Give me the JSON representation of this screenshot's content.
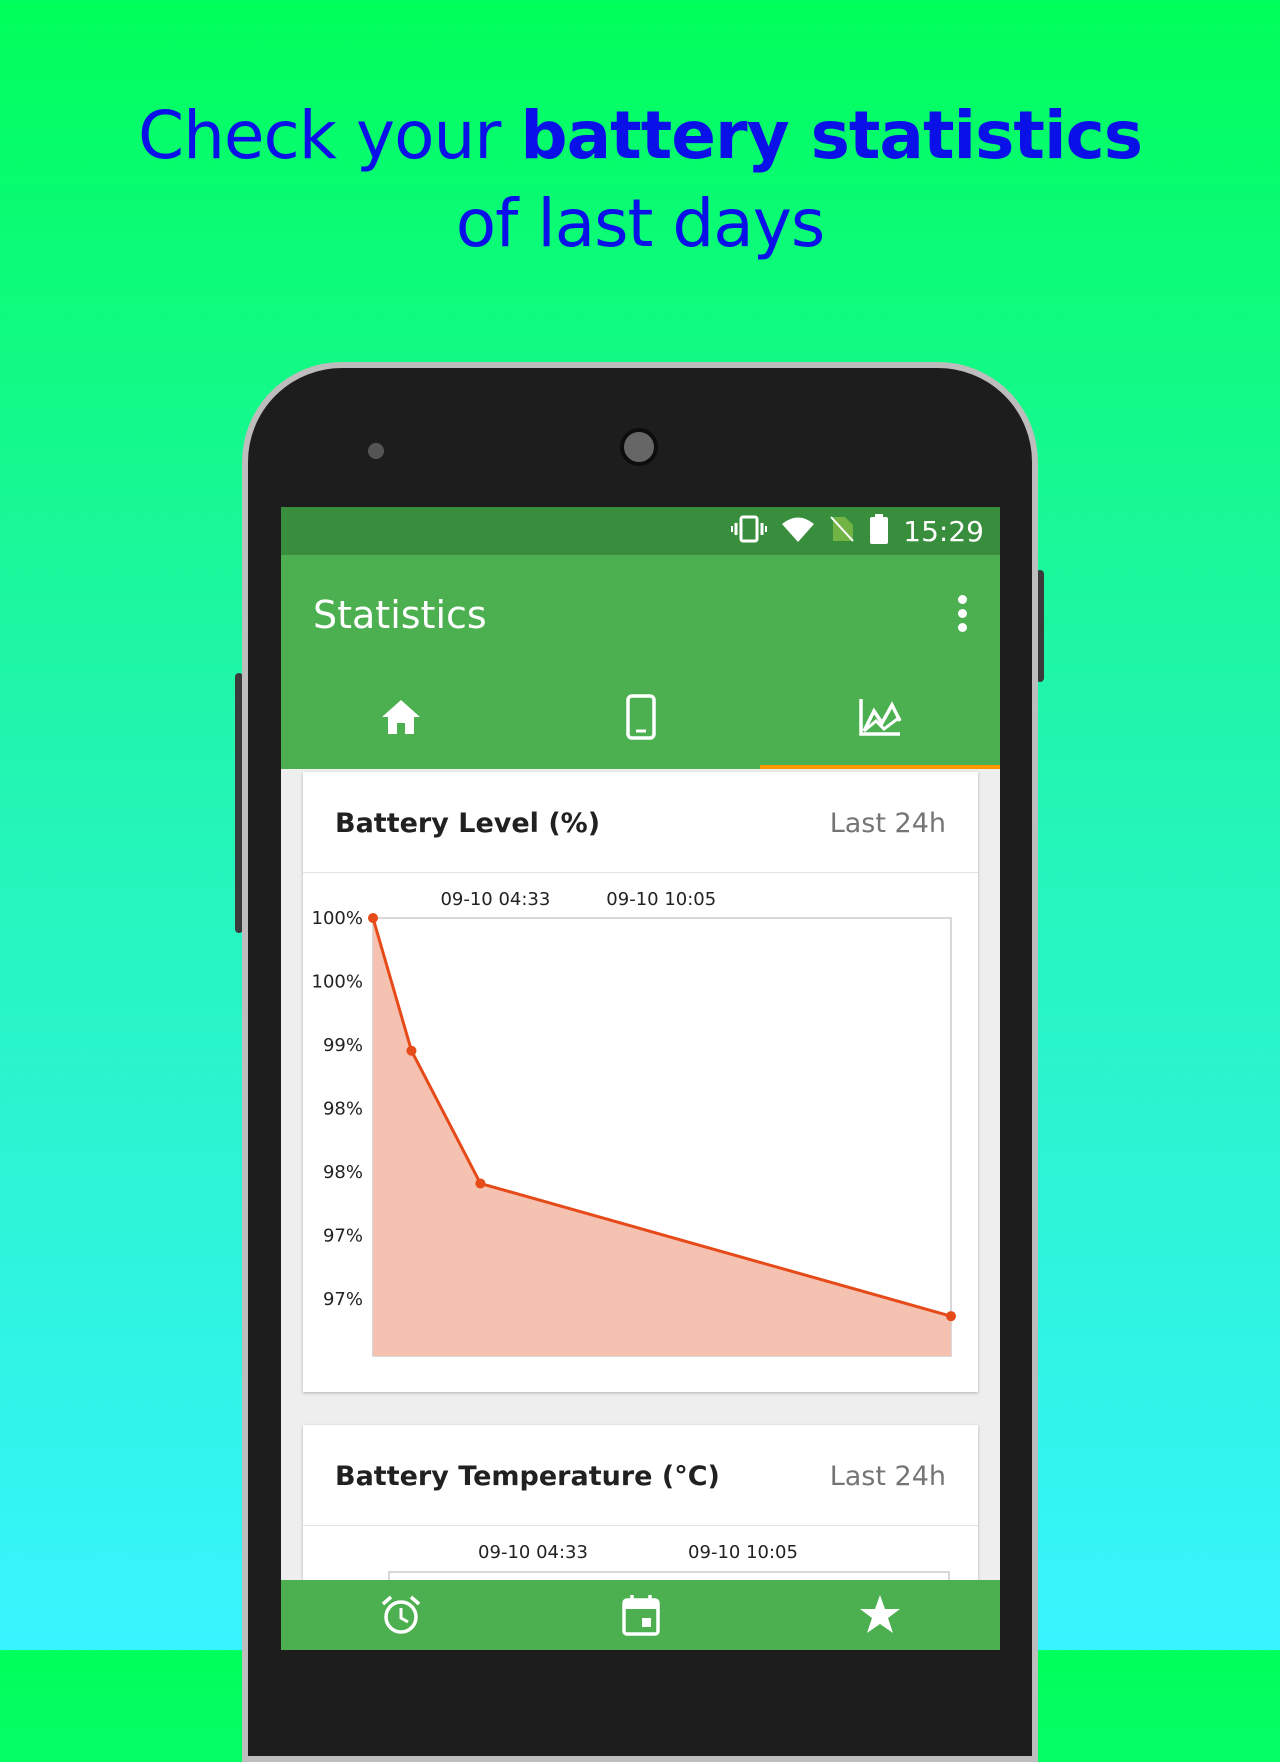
{
  "promo": {
    "line1_prefix": "Check your ",
    "line1_bold": "battery statistics",
    "line2": "of last days"
  },
  "status_bar": {
    "time": "15:29",
    "icons": [
      "vibrate-icon",
      "wifi-icon",
      "no-sim-icon",
      "battery-icon"
    ]
  },
  "app_bar": {
    "title": "Statistics",
    "menu_icon": "more-vert-icon"
  },
  "tabs": [
    {
      "icon": "home-icon",
      "active": false
    },
    {
      "icon": "phone-icon",
      "active": false
    },
    {
      "icon": "chart-icon",
      "active": true
    }
  ],
  "cards": {
    "level": {
      "title": "Battery Level (%)",
      "range": "Last 24h"
    },
    "temperature": {
      "title": "Battery Temperature (°C)",
      "range": "Last 24h"
    }
  },
  "chart_data": [
    {
      "type": "area",
      "title": "Battery Level (%)",
      "x_tick_labels": [
        "09-10 04:33",
        "09-10 10:05"
      ],
      "y_tick_labels": [
        "100%",
        "100%",
        "99%",
        "98%",
        "98%",
        "97%",
        "97%"
      ],
      "ylim": [
        96.7,
        100
      ],
      "series": [
        {
          "color": "#e64a19",
          "fill": "#f5c1b0",
          "points": [
            {
              "x": "09-10 00:28",
              "y": 100
            },
            {
              "x": "09-10 01:45",
              "y": 99
            },
            {
              "x": "09-10 04:03",
              "y": 98
            },
            {
              "x": "09-10 19:45",
              "y": 97
            }
          ]
        }
      ]
    },
    {
      "type": "line",
      "title": "Battery Temperature (°C)",
      "x_tick_labels": [
        "09-10 04:33",
        "09-10 10:05"
      ]
    }
  ],
  "bottom_nav": [
    {
      "icon": "alarm-icon"
    },
    {
      "icon": "calendar-icon"
    },
    {
      "icon": "star-icon"
    }
  ],
  "colors": {
    "primary": "#4caf50",
    "primary_dark": "#388e3c",
    "accent": "#ff9800",
    "line": "#e64a19",
    "headline": "#0a10e8"
  }
}
